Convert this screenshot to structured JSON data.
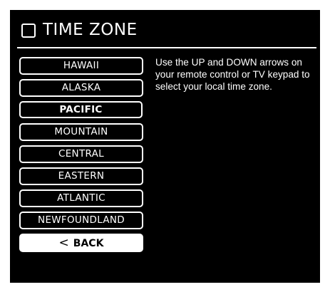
{
  "header": {
    "title": "TIME ZONE"
  },
  "timezones": [
    {
      "label": "HAWAII",
      "selected": false
    },
    {
      "label": "ALASKA",
      "selected": false
    },
    {
      "label": "PACIFIC",
      "selected": true
    },
    {
      "label": "MOUNTAIN",
      "selected": false
    },
    {
      "label": "CENTRAL",
      "selected": false
    },
    {
      "label": "EASTERN",
      "selected": false
    },
    {
      "label": "ATLANTIC",
      "selected": false
    },
    {
      "label": "NEWFOUNDLAND",
      "selected": false
    }
  ],
  "back": {
    "icon": "chevron-left-icon",
    "label": "BACK"
  },
  "help_text": "Use the UP and DOWN arrows on your remote control or TV keypad to select your local time zone.",
  "colors": {
    "background": "#000000",
    "foreground": "#ffffff"
  }
}
